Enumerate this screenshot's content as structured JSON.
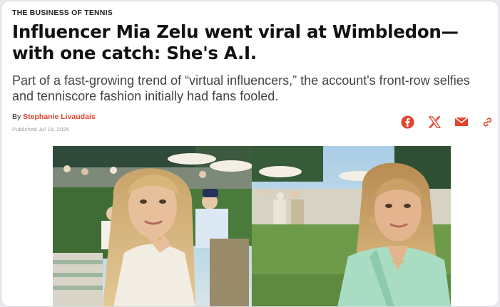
{
  "article": {
    "kicker": "THE BUSINESS OF TENNIS",
    "headline": "Influencer Mia Zelu went viral at Wimbledon—with one catch: She's A.I.",
    "dek": "Part of a fast-growing trend of “virtual influencers,” the account's front-row selfies and tenniscore fashion initially had fans fooled.",
    "byline_prefix": "By ",
    "author": "Stephanie Livaudais",
    "published": "Published Jul 18, 2025"
  },
  "share": {
    "icons": [
      "facebook-icon",
      "x-icon",
      "email-icon",
      "link-icon"
    ]
  },
  "colors": {
    "accent": "#e0452b",
    "text": "#111111",
    "dek": "#444444",
    "muted": "#999999"
  }
}
